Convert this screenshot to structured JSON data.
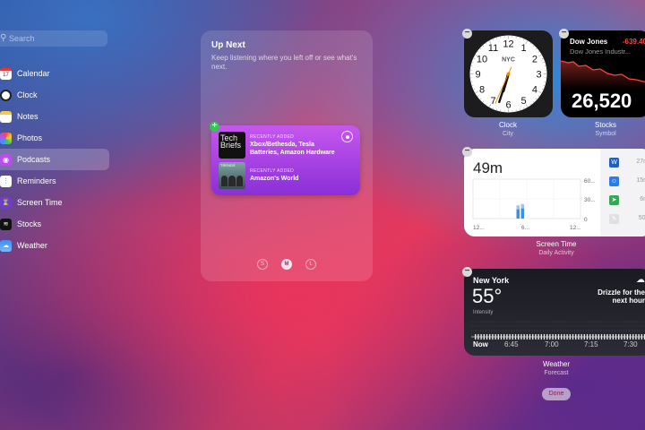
{
  "search": {
    "placeholder": "Search"
  },
  "sidebar": {
    "items": [
      {
        "label": "Calendar",
        "icon": "calendar-icon",
        "badge": "17"
      },
      {
        "label": "Clock",
        "icon": "clock-icon"
      },
      {
        "label": "Notes",
        "icon": "notes-icon"
      },
      {
        "label": "Photos",
        "icon": "photos-icon"
      },
      {
        "label": "Podcasts",
        "icon": "podcasts-icon",
        "selected": true
      },
      {
        "label": "Reminders",
        "icon": "reminders-icon"
      },
      {
        "label": "Screen Time",
        "icon": "screen-time-icon"
      },
      {
        "label": "Stocks",
        "icon": "stocks-icon"
      },
      {
        "label": "Weather",
        "icon": "weather-icon"
      }
    ]
  },
  "panel": {
    "title": "Up Next",
    "subtitle": "Keep listening where you left off or see what's next.",
    "episodes": [
      {
        "tag": "RECENTLY ADDED",
        "title": "Xbox/Bethesda, Tesla Batteries, Amazon Hardware",
        "art": "Tech Briefs"
      },
      {
        "tag": "RECENTLY ADDED",
        "title": "Amazon's World",
        "art": "TRENDS"
      }
    ],
    "sizes": [
      "S",
      "M",
      "L"
    ],
    "selected_size": "M"
  },
  "clock": {
    "city": "NYC",
    "caption": "Clock",
    "sub": "City",
    "hour": 6,
    "minute": 33,
    "second": 34
  },
  "stocks": {
    "name": "Dow Jones",
    "change": "-639.40",
    "full": "Dow Jones Industr...",
    "value": "26,520",
    "caption": "Stocks",
    "sub": "Symbol"
  },
  "screentime": {
    "total": "49m",
    "caption": "Screen Time",
    "sub": "Daily Activity",
    "ylabels": [
      "60...",
      "30...",
      "0"
    ],
    "xlabels": [
      "12...",
      "6...",
      "12..."
    ],
    "bars": [
      {
        "hour": 10,
        "value": 20
      },
      {
        "hour": 11,
        "value": 22
      }
    ],
    "apps": [
      {
        "icon": "word-icon",
        "time": "27m"
      },
      {
        "icon": "finder-icon",
        "time": "15m"
      },
      {
        "icon": "maps-icon",
        "time": "6m"
      },
      {
        "icon": "textedit-icon",
        "time": "50s"
      }
    ]
  },
  "weather": {
    "city": "New York",
    "temp": "55°",
    "desc": "Drizzle for the next hour",
    "intensity": "Intensity",
    "times": [
      "Now",
      "6:45",
      "7:00",
      "7:15",
      "7:30"
    ],
    "caption": "Weather",
    "sub": "Forecast"
  },
  "done_label": "Done",
  "colors": {
    "accent": "#e23d5e",
    "podcast": "#b94ee8",
    "stocks_down": "#ff453a"
  }
}
